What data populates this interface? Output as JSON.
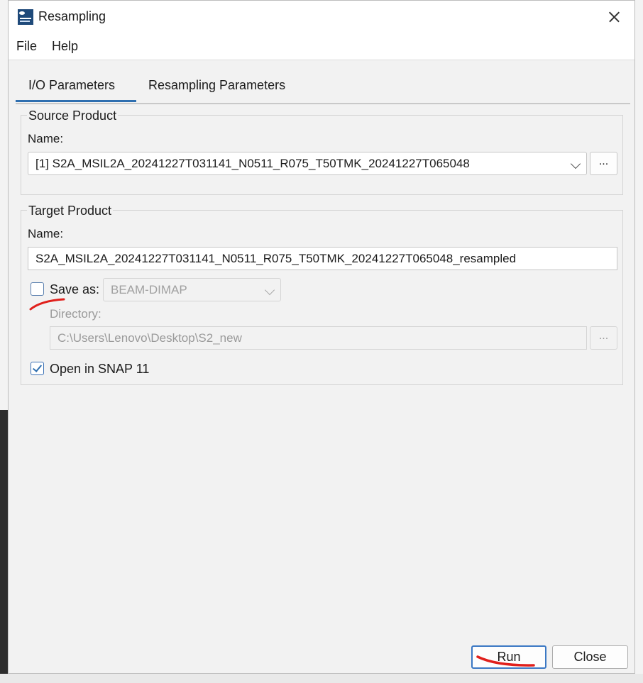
{
  "window": {
    "title": "Resampling",
    "app_icon": "snap-logo-icon"
  },
  "menu": {
    "items": [
      "File",
      "Help"
    ]
  },
  "tabs": [
    {
      "label": "I/O Parameters",
      "active": true
    },
    {
      "label": "Resampling Parameters",
      "active": false
    }
  ],
  "source_product": {
    "group_title": "Source Product",
    "name_label": "Name:",
    "selected_value": "[1] S2A_MSIL2A_20241227T031141_N0511_R075_T50TMK_20241227T065048",
    "browse_label": "..."
  },
  "target_product": {
    "group_title": "Target Product",
    "name_label": "Name:",
    "name_value": "S2A_MSIL2A_20241227T031141_N0511_R075_T50TMK_20241227T065048_resampled",
    "save_as_label": "Save as:",
    "save_as_checked": false,
    "format_value": "BEAM-DIMAP",
    "directory_label": "Directory:",
    "directory_value": "C:\\Users\\Lenovo\\Desktop\\S2_new",
    "directory_browse_label": "...",
    "open_in_snap_label": "Open in SNAP 11",
    "open_in_snap_checked": true
  },
  "buttons": {
    "run_label": "Run",
    "close_label": "Close"
  },
  "colors": {
    "accent": "#2f6fb0",
    "annotation": "#e0201c"
  }
}
